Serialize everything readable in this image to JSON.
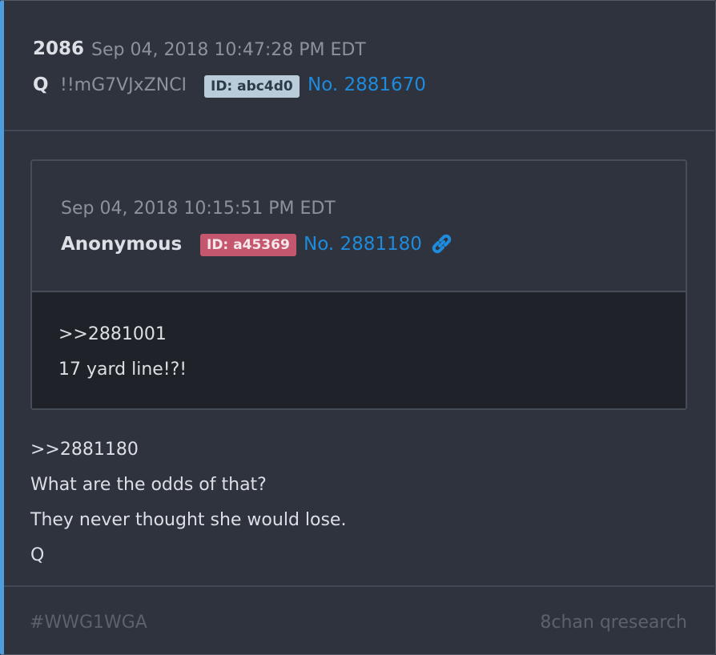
{
  "post": {
    "number": "2086",
    "timestamp": "Sep 04, 2018 10:47:28 PM EDT",
    "author": "Q",
    "tripcode": "!!mG7VJxZNCI",
    "id_label": "ID: abc4d0",
    "post_link": "No. 2881670",
    "id_badge_color": "#b8ccd9"
  },
  "quoted": {
    "timestamp": "Sep 04, 2018 10:15:51 PM EDT",
    "author": "Anonymous",
    "id_label": "ID: a45369",
    "post_link": "No. 2881180",
    "link_icon": "chain-link-icon",
    "id_badge_color": "#c4566e",
    "body_lines": [
      ">>2881001",
      "17 yard line!?!"
    ]
  },
  "message": {
    "lines": [
      ">>2881180",
      "What are the odds of that?",
      "They never thought she would lose.",
      "Q"
    ]
  },
  "footer": {
    "hashtag": "#WWG1WGA",
    "source": "8chan qresearch"
  },
  "colors": {
    "accent": "#4e9dde",
    "link": "#1e8bdc",
    "background": "#2e333d"
  }
}
